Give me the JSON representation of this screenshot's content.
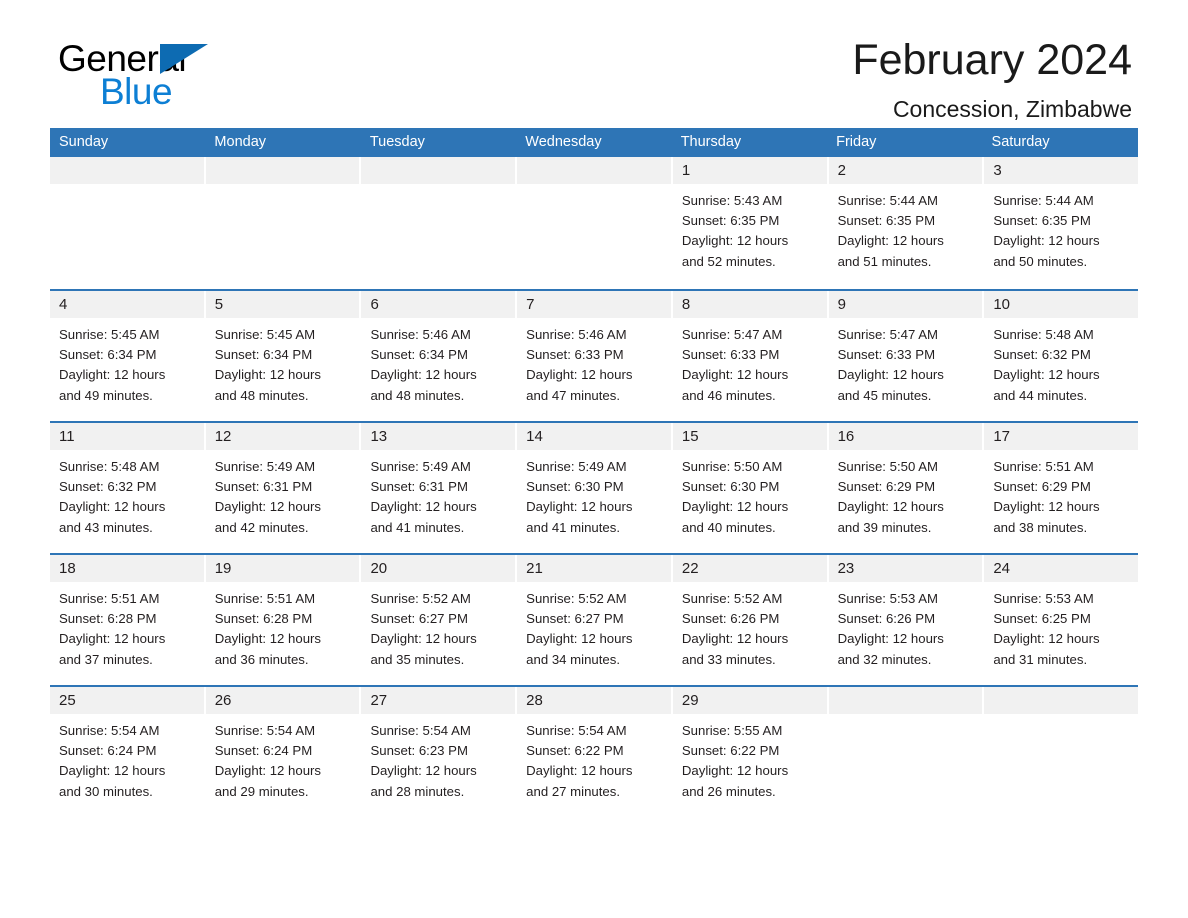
{
  "brand": {
    "name_part1": "General",
    "name_part2": "Blue",
    "triangle_color": "#0d6bb2",
    "blue_color": "#0d7fd4"
  },
  "header": {
    "title": "February 2024",
    "subtitle": "Concession, Zimbabwe",
    "accent_color": "#2e75b6",
    "daynum_band_color": "#f1f1f1"
  },
  "weekdays": [
    "Sunday",
    "Monday",
    "Tuesday",
    "Wednesday",
    "Thursday",
    "Friday",
    "Saturday"
  ],
  "labels": {
    "sunrise_prefix": "Sunrise:",
    "sunset_prefix": "Sunset:",
    "daylight_prefix": "Daylight:"
  },
  "weeks": [
    [
      {
        "day": "",
        "empty": true
      },
      {
        "day": "",
        "empty": true
      },
      {
        "day": "",
        "empty": true
      },
      {
        "day": "",
        "empty": true
      },
      {
        "day": "1",
        "sunrise": "Sunrise: 5:43 AM",
        "sunset": "Sunset: 6:35 PM",
        "daylight_line1": "Daylight: 12 hours",
        "daylight_line2": "and 52 minutes."
      },
      {
        "day": "2",
        "sunrise": "Sunrise: 5:44 AM",
        "sunset": "Sunset: 6:35 PM",
        "daylight_line1": "Daylight: 12 hours",
        "daylight_line2": "and 51 minutes."
      },
      {
        "day": "3",
        "sunrise": "Sunrise: 5:44 AM",
        "sunset": "Sunset: 6:35 PM",
        "daylight_line1": "Daylight: 12 hours",
        "daylight_line2": "and 50 minutes."
      }
    ],
    [
      {
        "day": "4",
        "sunrise": "Sunrise: 5:45 AM",
        "sunset": "Sunset: 6:34 PM",
        "daylight_line1": "Daylight: 12 hours",
        "daylight_line2": "and 49 minutes."
      },
      {
        "day": "5",
        "sunrise": "Sunrise: 5:45 AM",
        "sunset": "Sunset: 6:34 PM",
        "daylight_line1": "Daylight: 12 hours",
        "daylight_line2": "and 48 minutes."
      },
      {
        "day": "6",
        "sunrise": "Sunrise: 5:46 AM",
        "sunset": "Sunset: 6:34 PM",
        "daylight_line1": "Daylight: 12 hours",
        "daylight_line2": "and 48 minutes."
      },
      {
        "day": "7",
        "sunrise": "Sunrise: 5:46 AM",
        "sunset": "Sunset: 6:33 PM",
        "daylight_line1": "Daylight: 12 hours",
        "daylight_line2": "and 47 minutes."
      },
      {
        "day": "8",
        "sunrise": "Sunrise: 5:47 AM",
        "sunset": "Sunset: 6:33 PM",
        "daylight_line1": "Daylight: 12 hours",
        "daylight_line2": "and 46 minutes."
      },
      {
        "day": "9",
        "sunrise": "Sunrise: 5:47 AM",
        "sunset": "Sunset: 6:33 PM",
        "daylight_line1": "Daylight: 12 hours",
        "daylight_line2": "and 45 minutes."
      },
      {
        "day": "10",
        "sunrise": "Sunrise: 5:48 AM",
        "sunset": "Sunset: 6:32 PM",
        "daylight_line1": "Daylight: 12 hours",
        "daylight_line2": "and 44 minutes."
      }
    ],
    [
      {
        "day": "11",
        "sunrise": "Sunrise: 5:48 AM",
        "sunset": "Sunset: 6:32 PM",
        "daylight_line1": "Daylight: 12 hours",
        "daylight_line2": "and 43 minutes."
      },
      {
        "day": "12",
        "sunrise": "Sunrise: 5:49 AM",
        "sunset": "Sunset: 6:31 PM",
        "daylight_line1": "Daylight: 12 hours",
        "daylight_line2": "and 42 minutes."
      },
      {
        "day": "13",
        "sunrise": "Sunrise: 5:49 AM",
        "sunset": "Sunset: 6:31 PM",
        "daylight_line1": "Daylight: 12 hours",
        "daylight_line2": "and 41 minutes."
      },
      {
        "day": "14",
        "sunrise": "Sunrise: 5:49 AM",
        "sunset": "Sunset: 6:30 PM",
        "daylight_line1": "Daylight: 12 hours",
        "daylight_line2": "and 41 minutes."
      },
      {
        "day": "15",
        "sunrise": "Sunrise: 5:50 AM",
        "sunset": "Sunset: 6:30 PM",
        "daylight_line1": "Daylight: 12 hours",
        "daylight_line2": "and 40 minutes."
      },
      {
        "day": "16",
        "sunrise": "Sunrise: 5:50 AM",
        "sunset": "Sunset: 6:29 PM",
        "daylight_line1": "Daylight: 12 hours",
        "daylight_line2": "and 39 minutes."
      },
      {
        "day": "17",
        "sunrise": "Sunrise: 5:51 AM",
        "sunset": "Sunset: 6:29 PM",
        "daylight_line1": "Daylight: 12 hours",
        "daylight_line2": "and 38 minutes."
      }
    ],
    [
      {
        "day": "18",
        "sunrise": "Sunrise: 5:51 AM",
        "sunset": "Sunset: 6:28 PM",
        "daylight_line1": "Daylight: 12 hours",
        "daylight_line2": "and 37 minutes."
      },
      {
        "day": "19",
        "sunrise": "Sunrise: 5:51 AM",
        "sunset": "Sunset: 6:28 PM",
        "daylight_line1": "Daylight: 12 hours",
        "daylight_line2": "and 36 minutes."
      },
      {
        "day": "20",
        "sunrise": "Sunrise: 5:52 AM",
        "sunset": "Sunset: 6:27 PM",
        "daylight_line1": "Daylight: 12 hours",
        "daylight_line2": "and 35 minutes."
      },
      {
        "day": "21",
        "sunrise": "Sunrise: 5:52 AM",
        "sunset": "Sunset: 6:27 PM",
        "daylight_line1": "Daylight: 12 hours",
        "daylight_line2": "and 34 minutes."
      },
      {
        "day": "22",
        "sunrise": "Sunrise: 5:52 AM",
        "sunset": "Sunset: 6:26 PM",
        "daylight_line1": "Daylight: 12 hours",
        "daylight_line2": "and 33 minutes."
      },
      {
        "day": "23",
        "sunrise": "Sunrise: 5:53 AM",
        "sunset": "Sunset: 6:26 PM",
        "daylight_line1": "Daylight: 12 hours",
        "daylight_line2": "and 32 minutes."
      },
      {
        "day": "24",
        "sunrise": "Sunrise: 5:53 AM",
        "sunset": "Sunset: 6:25 PM",
        "daylight_line1": "Daylight: 12 hours",
        "daylight_line2": "and 31 minutes."
      }
    ],
    [
      {
        "day": "25",
        "sunrise": "Sunrise: 5:54 AM",
        "sunset": "Sunset: 6:24 PM",
        "daylight_line1": "Daylight: 12 hours",
        "daylight_line2": "and 30 minutes."
      },
      {
        "day": "26",
        "sunrise": "Sunrise: 5:54 AM",
        "sunset": "Sunset: 6:24 PM",
        "daylight_line1": "Daylight: 12 hours",
        "daylight_line2": "and 29 minutes."
      },
      {
        "day": "27",
        "sunrise": "Sunrise: 5:54 AM",
        "sunset": "Sunset: 6:23 PM",
        "daylight_line1": "Daylight: 12 hours",
        "daylight_line2": "and 28 minutes."
      },
      {
        "day": "28",
        "sunrise": "Sunrise: 5:54 AM",
        "sunset": "Sunset: 6:22 PM",
        "daylight_line1": "Daylight: 12 hours",
        "daylight_line2": "and 27 minutes."
      },
      {
        "day": "29",
        "sunrise": "Sunrise: 5:55 AM",
        "sunset": "Sunset: 6:22 PM",
        "daylight_line1": "Daylight: 12 hours",
        "daylight_line2": "and 26 minutes."
      },
      {
        "day": "",
        "empty": true
      },
      {
        "day": "",
        "empty": true
      }
    ]
  ]
}
